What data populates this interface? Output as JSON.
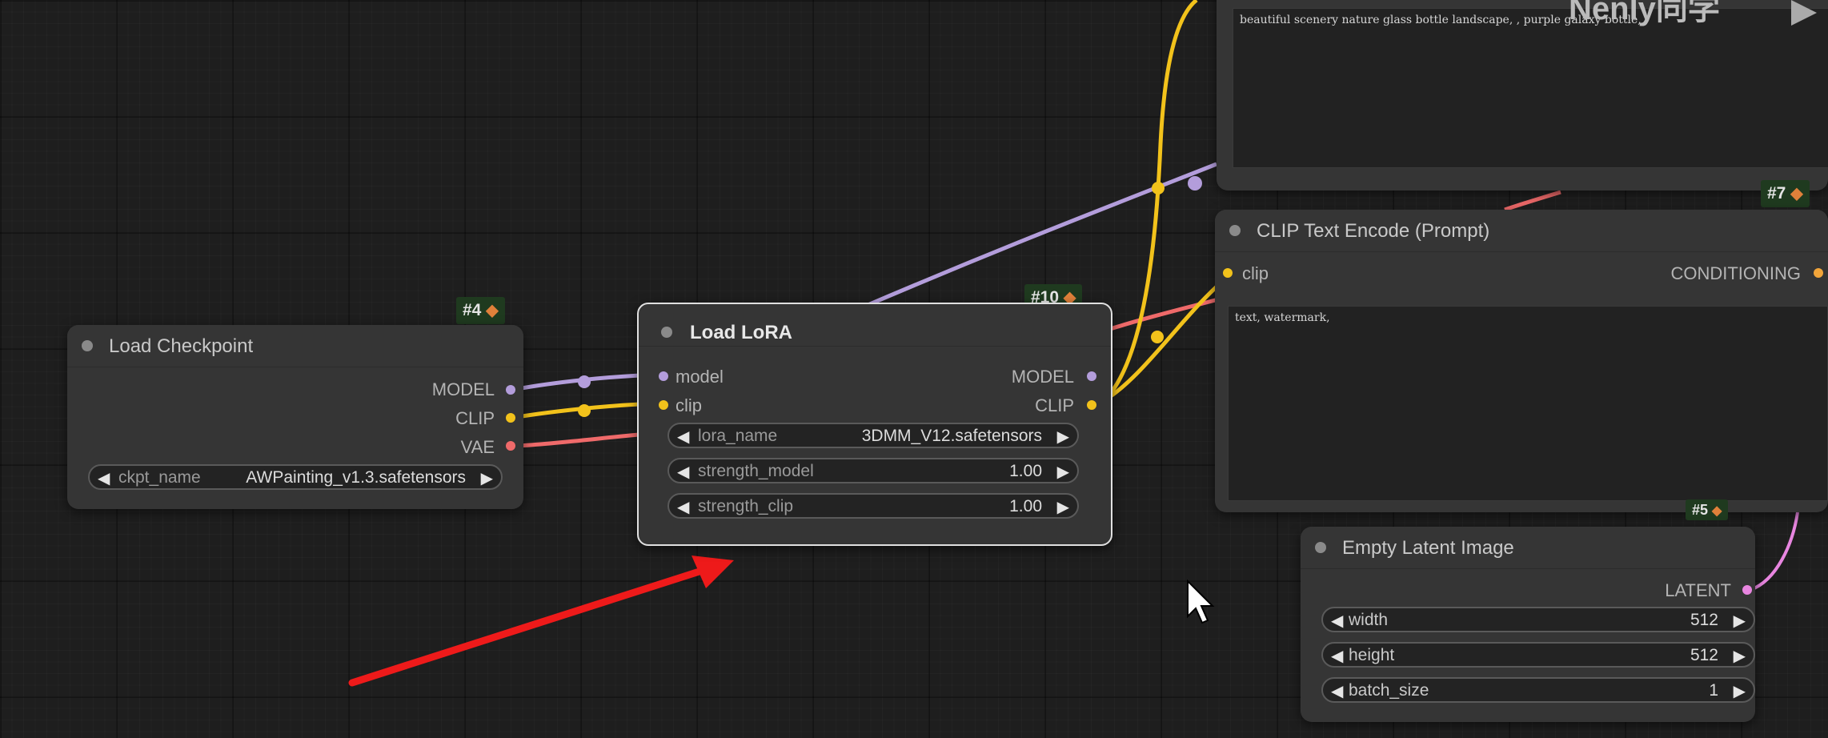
{
  "colors": {
    "model": "#b39ddb",
    "clip": "#f2c21b",
    "vae": "#ef6a6a",
    "latent": "#e886e0",
    "conditioning": "#f2a53a",
    "arrow": "#ee1a1a",
    "badge": "#1f3a1f"
  },
  "watermark": "Nenly同学",
  "nodes": {
    "checkpoint": {
      "badge": "#4",
      "title": "Load Checkpoint",
      "outputs": [
        "MODEL",
        "CLIP",
        "VAE"
      ],
      "widget": {
        "name": "ckpt_name",
        "value": "AWPainting_v1.3.safetensors"
      }
    },
    "lora": {
      "badge": "#10",
      "title": "Load LoRA",
      "inputs": [
        "model",
        "clip"
      ],
      "outputs": [
        "MODEL",
        "CLIP"
      ],
      "widgets": [
        {
          "name": "lora_name",
          "value": "3DMM_V12.safetensors"
        },
        {
          "name": "strength_model",
          "value": "1.00"
        },
        {
          "name": "strength_clip",
          "value": "1.00"
        }
      ]
    },
    "positive_prompt": {
      "text": "beautiful scenery nature glass bottle landscape, , purple galaxy bottle,"
    },
    "negative_prompt": {
      "badge": "#7",
      "title": "CLIP Text Encode (Prompt)",
      "input": "clip",
      "output": "CONDITIONING",
      "text": "text, watermark,"
    },
    "latent": {
      "badge": "#5",
      "title": "Empty Latent Image",
      "output": "LATENT",
      "widgets": [
        {
          "name": "width",
          "value": "512"
        },
        {
          "name": "height",
          "value": "512"
        },
        {
          "name": "batch_size",
          "value": "1"
        }
      ]
    }
  }
}
